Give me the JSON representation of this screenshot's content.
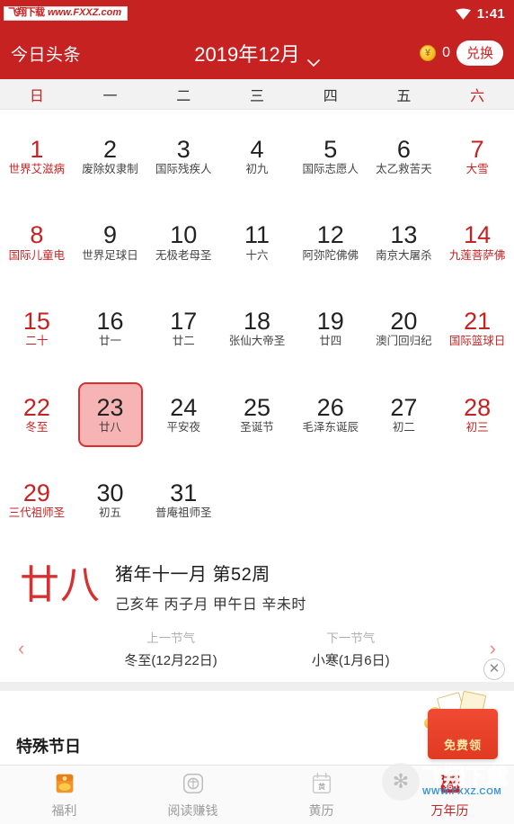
{
  "status_bar": {
    "watermark_cn": "飞翔下载",
    "watermark_url": "www.FXXZ.com",
    "wifi_icon": "wifi-icon",
    "time": "1:41"
  },
  "header": {
    "brand": "今日头条",
    "month_title": "2019年12月",
    "chevron_icon": "chevron-down-icon",
    "coin_icon": "coin-icon",
    "coin_count": "0",
    "redeem_label": "兑换"
  },
  "weekdays": [
    {
      "label": "日",
      "weekend": true
    },
    {
      "label": "一",
      "weekend": false
    },
    {
      "label": "二",
      "weekend": false
    },
    {
      "label": "三",
      "weekend": false
    },
    {
      "label": "四",
      "weekend": false
    },
    {
      "label": "五",
      "weekend": false
    },
    {
      "label": "六",
      "weekend": true
    }
  ],
  "calendar": {
    "cells": [
      {
        "day": "1",
        "lunar": "世界艾滋病",
        "style": "red"
      },
      {
        "day": "2",
        "lunar": "废除奴隶制",
        "style": "normal"
      },
      {
        "day": "3",
        "lunar": "国际残疾人",
        "style": "normal"
      },
      {
        "day": "4",
        "lunar": "初九",
        "style": "normal"
      },
      {
        "day": "5",
        "lunar": "国际志愿人",
        "style": "normal"
      },
      {
        "day": "6",
        "lunar": "太乙救苦天",
        "style": "normal"
      },
      {
        "day": "7",
        "lunar": "大雪",
        "style": "red"
      },
      {
        "day": "8",
        "lunar": "国际儿童电",
        "style": "red"
      },
      {
        "day": "9",
        "lunar": "世界足球日",
        "style": "normal"
      },
      {
        "day": "10",
        "lunar": "无极老母圣",
        "style": "normal"
      },
      {
        "day": "11",
        "lunar": "十六",
        "style": "normal"
      },
      {
        "day": "12",
        "lunar": "阿弥陀佛佛",
        "style": "normal"
      },
      {
        "day": "13",
        "lunar": "南京大屠杀",
        "style": "normal"
      },
      {
        "day": "14",
        "lunar": "九莲菩萨佛",
        "style": "red"
      },
      {
        "day": "15",
        "lunar": "二十",
        "style": "red"
      },
      {
        "day": "16",
        "lunar": "廿一",
        "style": "normal"
      },
      {
        "day": "17",
        "lunar": "廿二",
        "style": "normal"
      },
      {
        "day": "18",
        "lunar": "张仙大帝圣",
        "style": "normal"
      },
      {
        "day": "19",
        "lunar": "廿四",
        "style": "normal"
      },
      {
        "day": "20",
        "lunar": "澳门回归纪",
        "style": "normal"
      },
      {
        "day": "21",
        "lunar": "国际篮球日",
        "style": "red"
      },
      {
        "day": "22",
        "lunar": "冬至",
        "style": "red"
      },
      {
        "day": "23",
        "lunar": "廿八",
        "style": "selected"
      },
      {
        "day": "24",
        "lunar": "平安夜",
        "style": "normal"
      },
      {
        "day": "25",
        "lunar": "圣诞节",
        "style": "normal"
      },
      {
        "day": "26",
        "lunar": "毛泽东诞辰",
        "style": "normal"
      },
      {
        "day": "27",
        "lunar": "初二",
        "style": "normal"
      },
      {
        "day": "28",
        "lunar": "初三",
        "style": "red"
      },
      {
        "day": "29",
        "lunar": "三代祖师圣",
        "style": "red"
      },
      {
        "day": "30",
        "lunar": "初五",
        "style": "normal"
      },
      {
        "day": "31",
        "lunar": "普庵祖师圣",
        "style": "normal"
      },
      {
        "day": "",
        "lunar": "",
        "style": "empty"
      },
      {
        "day": "",
        "lunar": "",
        "style": "empty"
      },
      {
        "day": "",
        "lunar": "",
        "style": "empty"
      },
      {
        "day": "",
        "lunar": "",
        "style": "empty"
      }
    ]
  },
  "detail": {
    "big_lunar": "廿八",
    "line1": "猪年十一月  第52周",
    "line2": "己亥年 丙子月 甲午日 辛未时",
    "prev_arrow": "chevron-left-icon",
    "next_arrow": "chevron-right-icon",
    "prev_term_label": "上一节气",
    "prev_term_value": "冬至(12月22日)",
    "next_term_label": "下一节气",
    "next_term_value": "小寒(1月6日)"
  },
  "special_section": {
    "title": "特殊节日"
  },
  "float_ad": {
    "text": "免费领",
    "close_icon": "close-icon"
  },
  "bottom_nav": {
    "items": [
      {
        "label": "福利",
        "icon": "gift-envelope-icon",
        "active": false
      },
      {
        "label": "阅读赚钱",
        "icon": "read-earn-icon",
        "active": false
      },
      {
        "label": "黄历",
        "icon": "almanac-icon",
        "active": false
      },
      {
        "label": "万年历",
        "icon": "perpetual-calendar-icon",
        "active": true
      }
    ]
  },
  "corner_watermark": {
    "logo_icon": "feather-logo-icon",
    "cn": "飞翔下载",
    "url": "WWW.FXXZ.COM"
  },
  "colors": {
    "brand_red": "#c62222",
    "selected_fill": "#f6b4b4",
    "selected_border": "#d83030",
    "accent_orange": "#f0a821"
  }
}
